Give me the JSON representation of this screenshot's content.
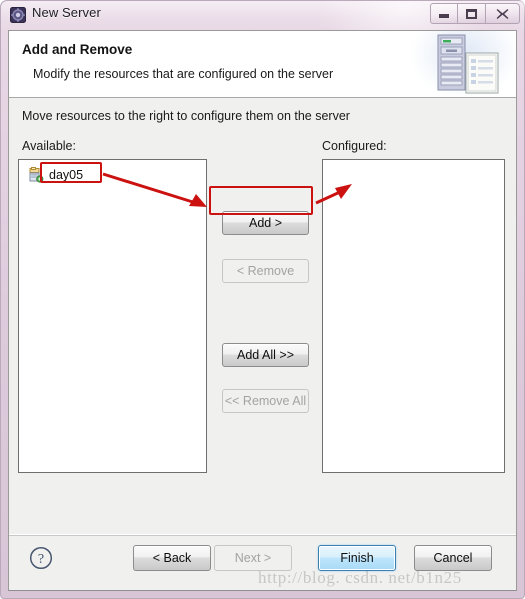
{
  "window": {
    "title": "New Server",
    "icon": "server-gear-icon",
    "controls": {
      "minimize": "Minimize",
      "maximize": "Maximize",
      "close": "Close"
    }
  },
  "header": {
    "title": "Add and Remove",
    "subtitle": "Modify the resources that are configured on the server",
    "icon": "server-and-document-icon"
  },
  "main": {
    "instruction": "Move resources to the right to configure them on the server",
    "available_label": "Available:",
    "configured_label": "Configured:",
    "available_items": [
      {
        "label": "day05",
        "icon": "dynamic-web-project-icon"
      }
    ],
    "configured_items": []
  },
  "transfer_buttons": {
    "add": "Add >",
    "remove": "< Remove",
    "add_all": "Add All >>",
    "remove_all": "<< Remove All"
  },
  "footer": {
    "help": "?",
    "back": "< Back",
    "next": "Next >",
    "finish": "Finish",
    "cancel": "Cancel"
  },
  "annotations": {
    "highlight_color": "#cc1111",
    "boxes": [
      "day05-item",
      "add-button"
    ],
    "arrows": [
      "day05-to-add-button",
      "add-button-to-configured-list"
    ]
  },
  "watermark": {
    "text": "http://blog. csdn. net/b1n25"
  },
  "colors": {
    "title_bar": "#e2cfe0",
    "dialog_bg": "#f0f0ef",
    "header_bg": "#ffffff",
    "default_button": "#bee6fd",
    "annotation": "#cc1111"
  }
}
